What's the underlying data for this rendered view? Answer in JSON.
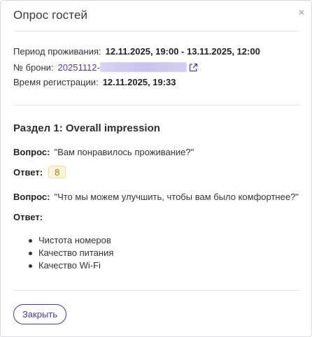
{
  "dialog": {
    "title": "Опрос гостей",
    "close_icon": "×"
  },
  "stay": {
    "period_label": "Период проживания:",
    "period_value": "12.11.2025, 19:00 - 13.11.2025, 12:00",
    "booking_label": "№ брони:",
    "booking_value": "20251112-",
    "registration_label": "Время регистрации:",
    "registration_value": "12.11.2025, 19:33"
  },
  "section": {
    "title": "Раздел 1: Overall impression",
    "q1": {
      "question_label": "Вопрос:",
      "question_text": "\"Вам понравилось проживание?\"",
      "answer_label": "Ответ:",
      "answer_value": "8"
    },
    "q2": {
      "question_label": "Вопрос:",
      "question_text": "\"Что мы можем улучшить, чтобы вам было комфортнее?\"",
      "answer_label": "Ответ:",
      "answers": [
        "Чистота номеров",
        "Качество питания",
        "Качество Wi-Fi"
      ]
    }
  },
  "footer": {
    "close_button": "Закрыть"
  },
  "colors": {
    "accent": "#4a3c8f",
    "badge_bg": "#fff5dc",
    "badge_text": "#a07a10"
  }
}
